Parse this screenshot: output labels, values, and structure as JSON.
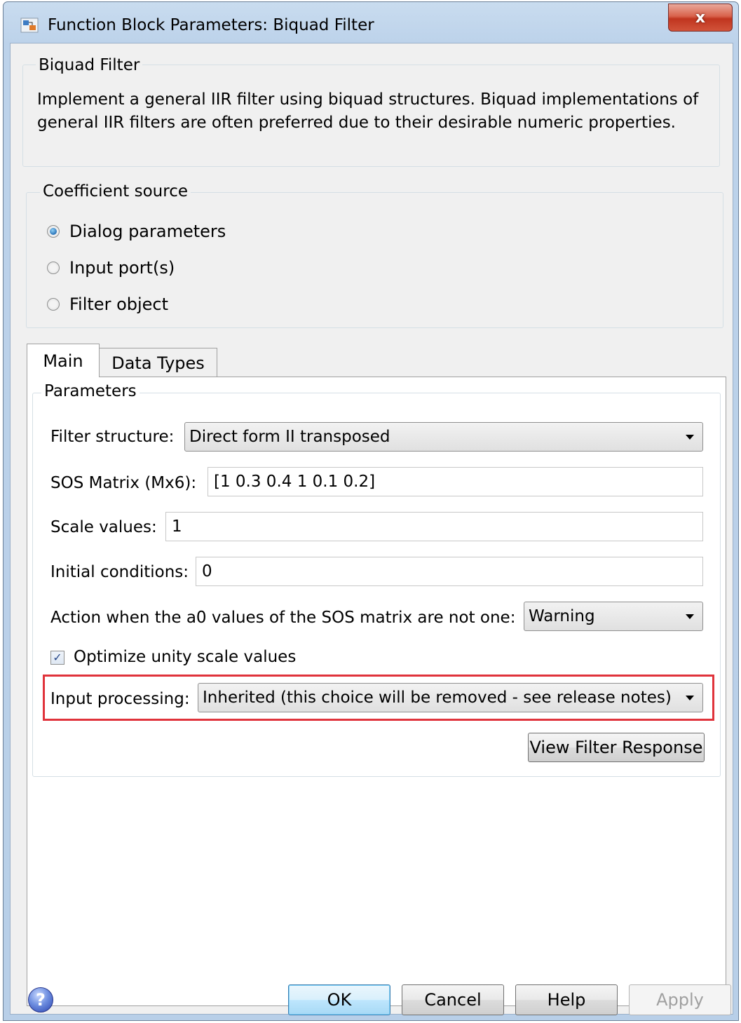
{
  "window": {
    "title": "Function Block Parameters: Biquad Filter",
    "close_label": "x"
  },
  "description": {
    "group_title": "Biquad Filter",
    "text": "Implement a general IIR filter using biquad structures. Biquad implementations of general IIR filters are often preferred due to their desirable numeric properties."
  },
  "coefficient_source": {
    "group_title": "Coefficient source",
    "options": [
      {
        "label": "Dialog parameters",
        "selected": true
      },
      {
        "label": "Input port(s)",
        "selected": false
      },
      {
        "label": "Filter object",
        "selected": false
      }
    ]
  },
  "tabs": [
    {
      "label": "Main",
      "active": true
    },
    {
      "label": "Data Types",
      "active": false
    }
  ],
  "parameters": {
    "group_title": "Parameters",
    "filter_structure": {
      "label": "Filter structure:",
      "value": "Direct form II transposed"
    },
    "sos_matrix": {
      "label": "SOS Matrix (Mx6):",
      "value": "[1 0.3 0.4 1 0.1 0.2]"
    },
    "scale_values": {
      "label": "Scale values:",
      "value": "1"
    },
    "initial_conditions": {
      "label": "Initial conditions:",
      "value": "0"
    },
    "a0_action": {
      "label": "Action when the a0 values of the SOS matrix are not one:",
      "value": "Warning"
    },
    "optimize_unity": {
      "label": "Optimize unity scale values",
      "checked": true
    },
    "input_processing": {
      "label": "Input processing:",
      "value": "Inherited (this choice will be removed - see release notes)"
    },
    "view_filter_response": "View Filter Response"
  },
  "buttons": {
    "ok": "OK",
    "cancel": "Cancel",
    "help": "Help",
    "apply": "Apply"
  },
  "colors": {
    "highlight_border": "#e0333b",
    "close_button": "#c8402a"
  }
}
